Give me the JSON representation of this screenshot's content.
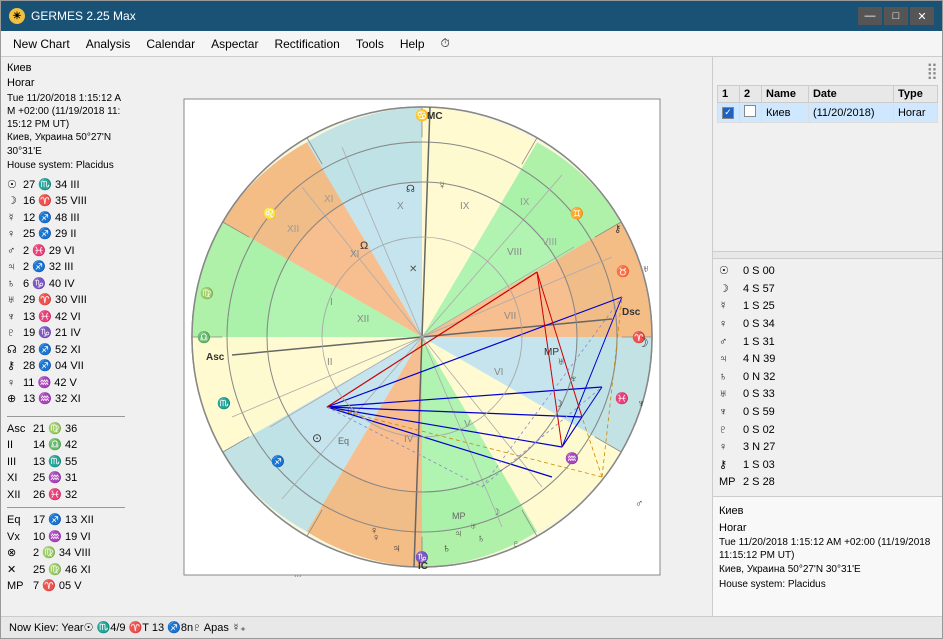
{
  "window": {
    "title": "GERMES 2.25 Max",
    "icon": "☀"
  },
  "title_controls": {
    "minimize": "—",
    "maximize": "□",
    "close": "✕"
  },
  "menu": {
    "items": [
      {
        "label": "New Chart",
        "id": "new-chart"
      },
      {
        "label": "Analysis",
        "id": "analysis"
      },
      {
        "label": "Calendar",
        "id": "calendar"
      },
      {
        "label": "Aspectar",
        "id": "aspectar"
      },
      {
        "label": "Rectification",
        "id": "rectification"
      },
      {
        "label": "Tools",
        "id": "tools"
      },
      {
        "label": "Help",
        "id": "help"
      }
    ]
  },
  "chart_info": {
    "city": "Киев",
    "type": "Horar",
    "date_line": "Tue 11/20/2018 1:15:12 AM +02:00 (11/19/2018 11:15:12 PM UT)",
    "location": "Киев, Украина 50°27'N 30°31'E",
    "house_system": "House system: Placidus"
  },
  "planets": [
    {
      "symbol": "☉",
      "value": "27 ♏ 34 III"
    },
    {
      "symbol": "☽",
      "value": "16 ♈ 35 VIII"
    },
    {
      "symbol": "☿",
      "value": "12 ♐ 48 III"
    },
    {
      "symbol": "♀",
      "value": "25 ♐ 29 II"
    },
    {
      "symbol": "♂",
      "value": "2 ♓ 29 VI"
    },
    {
      "symbol": "♃",
      "value": "2 ♐ 32 III"
    },
    {
      "symbol": "♄",
      "value": "6 ♑ 40 IV"
    },
    {
      "symbol": "⛢",
      "value": "29 ♈ 30 VIII"
    },
    {
      "symbol": "♆",
      "value": "13 ♓ 42 VI"
    },
    {
      "symbol": "♇",
      "value": "19 ♑ 21 IV"
    },
    {
      "symbol": "☊",
      "value": "28 ♐ 52 XI"
    },
    {
      "symbol": "⚷",
      "value": "28 ♐ 04 VII"
    },
    {
      "symbol": "♀",
      "value": "11 ♒ 42 V"
    },
    {
      "symbol": "⊕",
      "value": "13 ♒ 32 XI"
    }
  ],
  "houses": [
    {
      "label": "Asc",
      "value": "21 ♍ 36"
    },
    {
      "label": "II",
      "value": "14 ♎ 42"
    },
    {
      "label": "III",
      "value": "13 ♏ 55"
    },
    {
      "label": "XI",
      "value": "25 ♒ 31"
    },
    {
      "label": "XII",
      "value": "26 ♓ 32"
    },
    {
      "label": "Eq",
      "value": "17 ♐ 13 XII"
    },
    {
      "label": "Vx",
      "value": "10 ♒ 19 VI"
    },
    {
      "label": "⊗",
      "value": "2 ♍ 34 VIII"
    },
    {
      "label": "✕",
      "value": "25 ♍ 46 XI"
    },
    {
      "label": "MP",
      "value": "7 ♈ 05 V"
    }
  ],
  "right_panel": {
    "col_headers": [
      "1",
      "2",
      "Name",
      "Date",
      "Type"
    ],
    "rows": [
      {
        "checked1": true,
        "checked2": false,
        "name": "Киев",
        "date": "(11/20/2018)",
        "type": "Horar"
      }
    ]
  },
  "planet_positions_right": [
    {
      "symbol": "☉",
      "value": "0 S 00"
    },
    {
      "symbol": "☽",
      "value": "4 S 57"
    },
    {
      "symbol": "☿",
      "value": "1 S 25"
    },
    {
      "symbol": "♀",
      "value": "0 S 34"
    },
    {
      "symbol": "♂",
      "value": "1 S 31"
    },
    {
      "symbol": "♃",
      "value": "4 N 39"
    },
    {
      "symbol": "♄",
      "value": "0 N 32"
    },
    {
      "symbol": "⛢",
      "value": "0 S 33"
    },
    {
      "symbol": "♆",
      "value": "0 S 59"
    },
    {
      "symbol": "♇",
      "value": "0 S 02"
    },
    {
      "symbol": "♀",
      "value": "3 N 27"
    },
    {
      "symbol": "⚷",
      "value": "1 S 03"
    },
    {
      "symbol": "MP",
      "value": "2 S 28"
    }
  ],
  "bottom_info": {
    "city": "Киев",
    "type": "Horar",
    "date_line": "Tue 11/20/2018 1:15:12 AM +02:00 (11/19/2018 11:15:12 PM UT)",
    "location": "Киев, Украина 50°27'N 30°31'E",
    "house_system": "House system: Placidus"
  },
  "status_bar": {
    "text": "Now Kiev:  Year☉  ♏4/9  ♈T 13  ♐8n♇  Apas  ☿₊"
  },
  "chart_data": {
    "zodiac_signs": [
      "♈",
      "♉",
      "♊",
      "♋",
      "♌",
      "♍",
      "♎",
      "♏",
      "♐",
      "♑",
      "♒",
      "♓"
    ],
    "house_labels": [
      "I",
      "II",
      "III",
      "IV",
      "V",
      "VI",
      "VII",
      "VIII",
      "IX",
      "X",
      "XI",
      "XII"
    ],
    "directions": [
      "MC",
      "IC",
      "Asc",
      "Dsc"
    ]
  }
}
